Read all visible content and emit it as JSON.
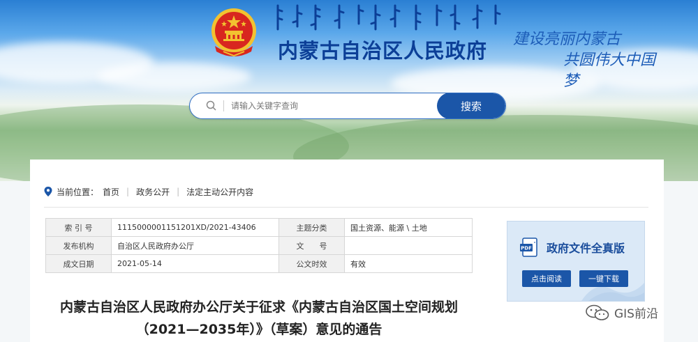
{
  "header": {
    "site_title": "内蒙古自治区人民政府",
    "slogan_line1": "建设亮丽内蒙古",
    "slogan_line2": "共圆伟大中国梦"
  },
  "search": {
    "placeholder": "请输入关键字查询",
    "button_label": "搜索"
  },
  "breadcrumb": {
    "label": "当前位置：",
    "items": [
      "首页",
      "政务公开",
      "法定主动公开内容"
    ]
  },
  "meta": {
    "rows": [
      {
        "k1": "索 引 号",
        "v1": "1115000001151201XD/2021-43406",
        "k2": "主题分类",
        "v2": "国土资源、能源 \\ 土地"
      },
      {
        "k1": "发布机构",
        "v1": "自治区人民政府办公厅",
        "k2": "文　　号",
        "v2": ""
      },
      {
        "k1": "成文日期",
        "v1": "2021-05-14",
        "k2": "公文时效",
        "v2": "有效"
      }
    ]
  },
  "document": {
    "title_line1": "内蒙古自治区人民政府办公厅关于征求《内蒙古自治区国土空间规划",
    "title_line2": "（2021—2035年）》（草案）意见的通告"
  },
  "card": {
    "title": "政府文件全真版",
    "read_label": "点击阅读",
    "download_label": "一键下载"
  },
  "watermark": {
    "text": "GIS前沿"
  },
  "colors": {
    "brand_blue": "#1b56a8",
    "title_blue": "#0c3f97",
    "emblem_red": "#d8261f",
    "emblem_gold": "#f2c230"
  }
}
